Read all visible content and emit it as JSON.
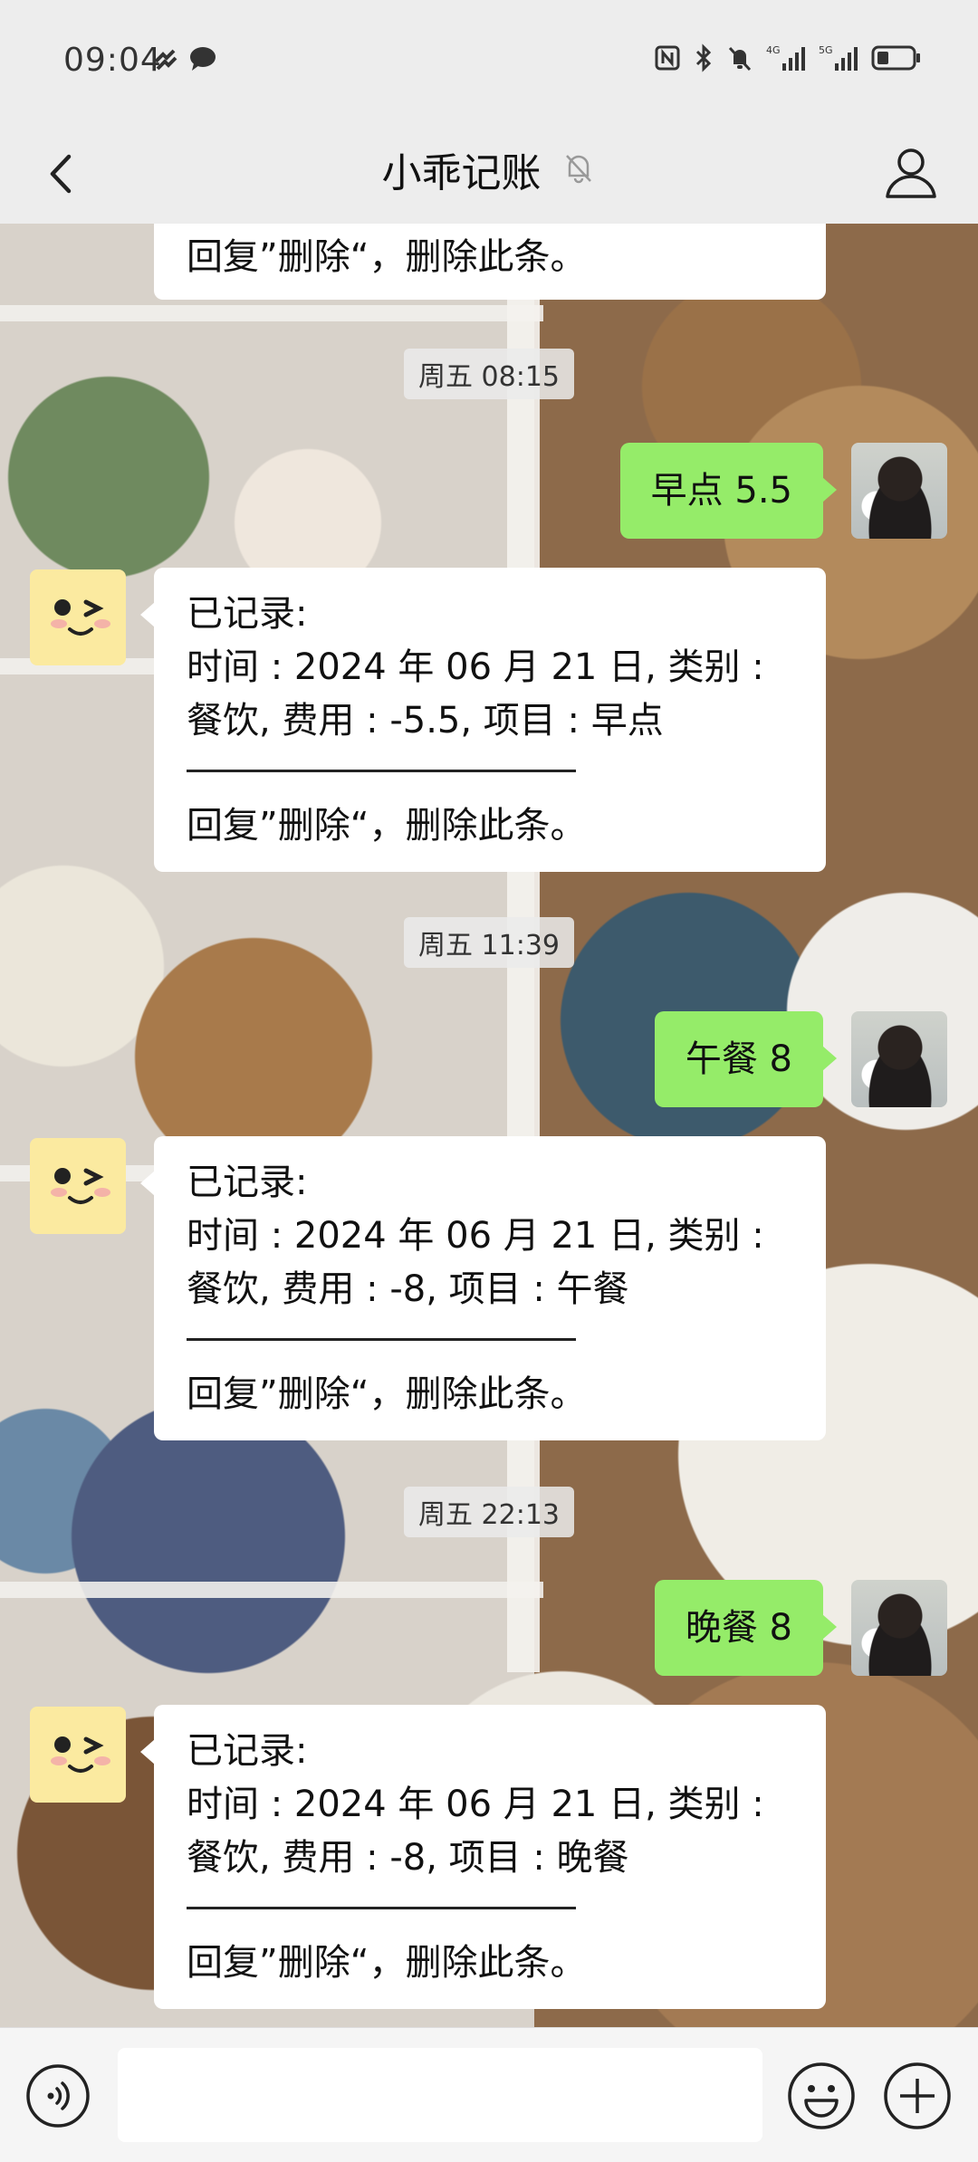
{
  "status_bar": {
    "time": "09:04",
    "left_icons": [
      "sync-icon",
      "message-icon"
    ],
    "right_icons": [
      "nfc-icon",
      "bluetooth-icon",
      "mute-icon",
      "signal-4g-icon",
      "signal-5g-icon",
      "battery-icon"
    ],
    "signal_4g_label": "4G",
    "signal_5g_label": "5G"
  },
  "header": {
    "title": "小乖记账",
    "back_icon": "chevron-left-icon",
    "mute_icon": "bell-off-icon",
    "profile_icon": "person-icon"
  },
  "chat": {
    "top_cut_message": {
      "footer": "回复”删除“，删除此条。"
    },
    "groups": [
      {
        "timestamp": "周五 08:15",
        "user_message": "早点 5.5",
        "bot_reply": {
          "title": "已记录:",
          "line1": "时间 : 2024 年 06 月 21 日, 类别 :",
          "line2": "餐饮, 费用 : -5.5, 项目 : 早点",
          "footer": "回复”删除“，删除此条。"
        }
      },
      {
        "timestamp": "周五 11:39",
        "user_message": "午餐 8",
        "bot_reply": {
          "title": "已记录:",
          "line1": "时间 : 2024 年 06 月 21 日, 类别 :",
          "line2": "餐饮, 费用 : -8, 项目 : 午餐",
          "footer": "回复”删除“，删除此条。"
        }
      },
      {
        "timestamp": "周五 22:13",
        "user_message": "晚餐 8",
        "bot_reply": {
          "title": "已记录:",
          "line1": "时间 : 2024 年 06 月 21 日, 类别 :",
          "line2": "餐饮, 费用 : -8, 项目 : 晚餐",
          "footer": "回复”删除“，删除此条。"
        }
      }
    ]
  },
  "input_bar": {
    "value": "",
    "placeholder": "",
    "voice_icon": "voice-icon",
    "emoji_icon": "emoji-icon",
    "plus_icon": "plus-icon"
  },
  "colors": {
    "user_bubble": "#95ec69",
    "bot_bubble": "#ffffff",
    "bot_avatar": "#fbeaa0",
    "bar_background": "#ededed"
  }
}
